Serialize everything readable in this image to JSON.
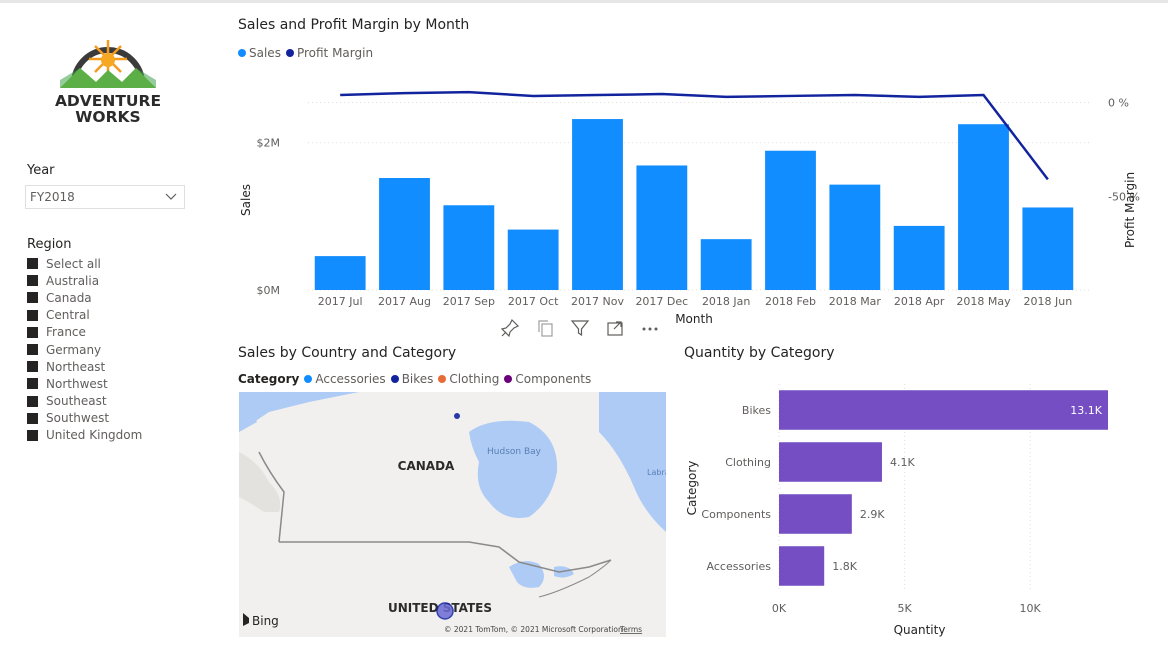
{
  "brand": {
    "line1": "ADVENTURE",
    "line2": "WORKS"
  },
  "year_slicer": {
    "title": "Year",
    "selected": "FY2018"
  },
  "region_slicer": {
    "title": "Region",
    "items": [
      "Select all",
      "Australia",
      "Canada",
      "Central",
      "France",
      "Germany",
      "Northeast",
      "Northwest",
      "Southeast",
      "Southwest",
      "United Kingdom"
    ]
  },
  "colors": {
    "sales": "#118dff",
    "profit_margin": "#12239e",
    "accessories": "#118dff",
    "bikes": "#12239e",
    "clothing": "#e66c37",
    "components": "#6b007b",
    "quantity_bar": "#744ec2"
  },
  "sales_chart": {
    "title": "Sales and Profit Margin by Month",
    "legend": [
      "Sales",
      "Profit Margin"
    ]
  },
  "map_visual": {
    "title": "Sales by Country and Category",
    "legend_title": "Category",
    "legend": [
      "Accessories",
      "Bikes",
      "Clothing",
      "Components"
    ],
    "labels": {
      "canada": "CANADA",
      "usa": "UNITED STATES",
      "hudson": "Hudson Bay",
      "labrador": "Labra"
    },
    "bing": "Bing",
    "copyright": "© 2021 TomTom, © 2021 Microsoft Corporation",
    "terms": "Terms"
  },
  "quantity_chart": {
    "title": "Quantity by Category"
  },
  "visual_header_icons": [
    "pin-icon",
    "copy-icon",
    "filter-icon",
    "focus-mode-icon",
    "more-options-icon"
  ],
  "chart_data": [
    {
      "type": "bar",
      "title": "Sales and Profit Margin by Month",
      "categories": [
        "2017 Jul",
        "2017 Aug",
        "2017 Sep",
        "2017 Oct",
        "2017 Nov",
        "2017 Dec",
        "2018 Jan",
        "2018 Feb",
        "2018 Mar",
        "2018 Apr",
        "2018 May",
        "2018 Jun"
      ],
      "xlabel": "Month",
      "ylabel": "Sales",
      "y2label": "Profit Margin",
      "yticks": [
        "$0M",
        "$2M"
      ],
      "y2ticks": [
        "0 %",
        "-50 %"
      ],
      "ylim": [
        0,
        2.85
      ],
      "y2lim": [
        -100,
        12
      ],
      "series": [
        {
          "name": "Sales",
          "axis": "left",
          "type": "bar",
          "values": [
            0.46,
            1.52,
            1.15,
            0.82,
            2.32,
            1.69,
            0.69,
            1.89,
            1.43,
            0.87,
            2.25,
            1.12
          ]
        },
        {
          "name": "Profit Margin",
          "axis": "right",
          "type": "line",
          "values": [
            4,
            5,
            5.5,
            3.5,
            4,
            4.5,
            3,
            3.5,
            4,
            3,
            4,
            -41
          ]
        }
      ],
      "grid": true
    },
    {
      "type": "bar",
      "orientation": "horizontal",
      "title": "Quantity by Category",
      "categories": [
        "Bikes",
        "Clothing",
        "Components",
        "Accessories"
      ],
      "values": [
        13100,
        4100,
        2900,
        1800
      ],
      "data_labels": [
        "13.1K",
        "4.1K",
        "2.9K",
        "1.8K"
      ],
      "xlabel": "Quantity",
      "ylabel": "Category",
      "xticks": [
        "0K",
        "5K",
        "10K"
      ],
      "xlim": [
        0,
        13100
      ]
    }
  ]
}
